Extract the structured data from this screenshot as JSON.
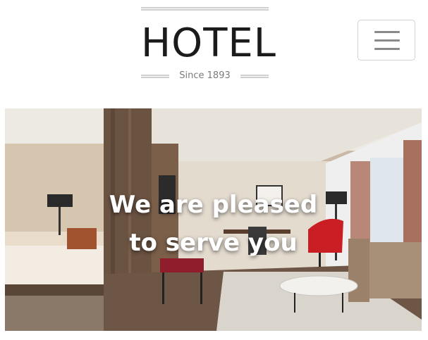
{
  "header": {
    "brand": "HOTEL",
    "tagline": "Since 1893"
  },
  "menu_toggle": {
    "icon": "hamburger-menu-icon"
  },
  "hero": {
    "headline_line1": "We are pleased",
    "headline_line2": "to serve you",
    "image_alt": "hotel-room-photo"
  }
}
